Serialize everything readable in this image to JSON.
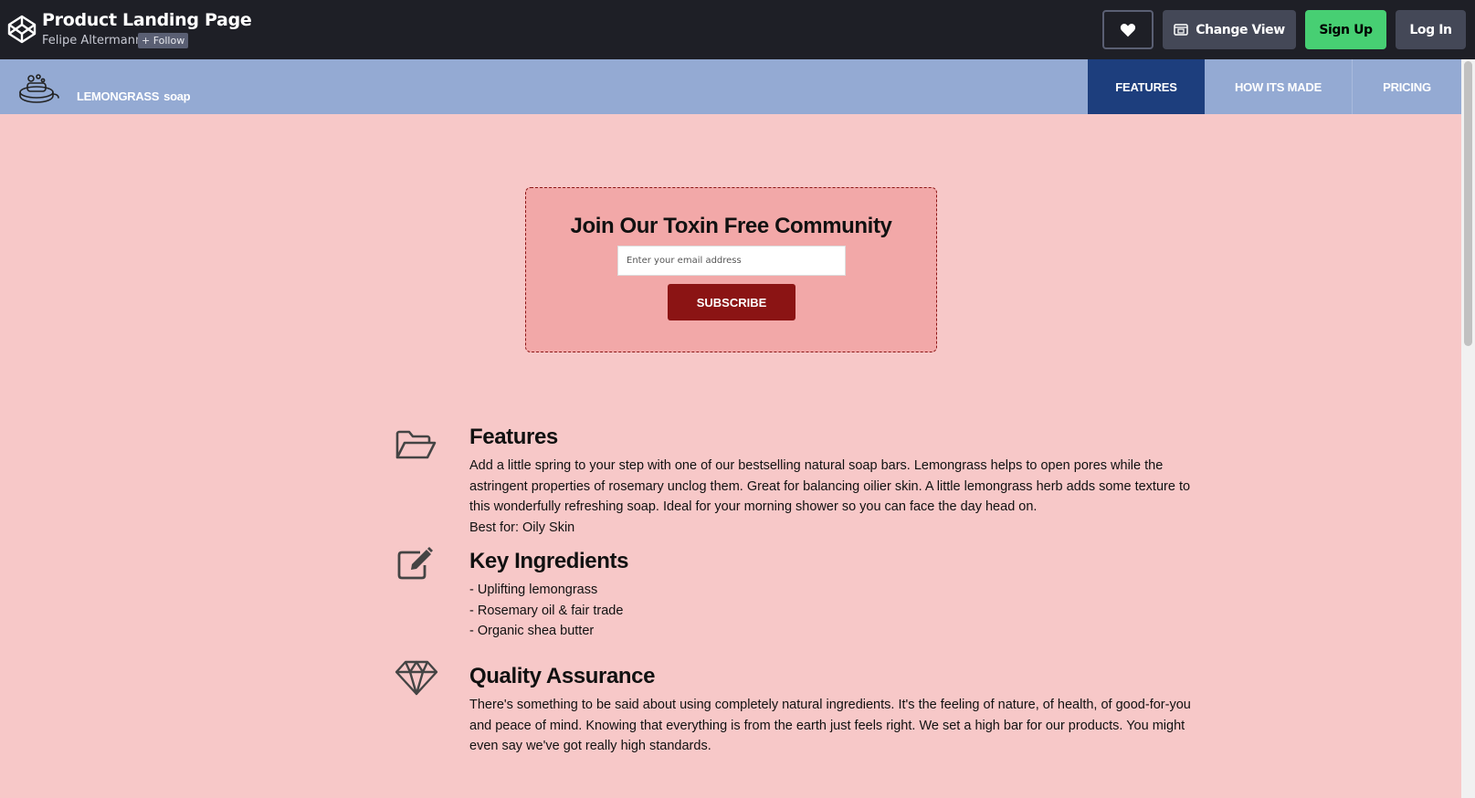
{
  "topbar": {
    "title": "Product Landing Page",
    "author": "Felipe Altermann",
    "follow_label": "+ Follow",
    "change_view_label": "Change View",
    "signup_label": "Sign Up",
    "login_label": "Log In"
  },
  "header": {
    "brand_main": "LEMONGRASS",
    "brand_sub": "soap",
    "nav": [
      {
        "label": "FEATURES"
      },
      {
        "label": "HOW ITS MADE"
      },
      {
        "label": "PRICING"
      }
    ]
  },
  "subscribe": {
    "title": "Join Our Toxin Free Community",
    "email_placeholder": "Enter your email address",
    "button_label": "SUBSCRIBE"
  },
  "features": [
    {
      "icon": "folder-open-icon",
      "title": "Features",
      "lines": [
        "Add a little spring to your step with one of our bestselling natural soap bars. Lemongrass helps to open pores while the astringent properties of rosemary unclog them. Great for balancing oilier skin. A little lemongrass herb adds some texture to this wonderfully refreshing soap. Ideal for your morning shower so you can face the day head on.",
        "Best for: Oily Skin"
      ]
    },
    {
      "icon": "edit-icon",
      "title": "Key Ingredients",
      "lines": [
        "- Uplifting lemongrass",
        "- Rosemary oil & fair trade",
        "- Organic shea butter"
      ]
    },
    {
      "icon": "diamond-icon",
      "title": "Quality Assurance",
      "lines": [
        "There's something to be said about using completely natural ingredients. It's the feeling of nature, of health, of good-for-you and peace of mind. Knowing that everything is from the earth just feels right. We set a high bar for our products. You might even say we've got really high standards."
      ]
    }
  ],
  "colors": {
    "page_bg": "#f7c8c8",
    "header_bg": "#94aad3",
    "nav_active": "#1d3e7d",
    "subscribe_bg": "#f2a8a8",
    "subscribe_button": "#8b1414",
    "signup_green": "#47cf73"
  }
}
